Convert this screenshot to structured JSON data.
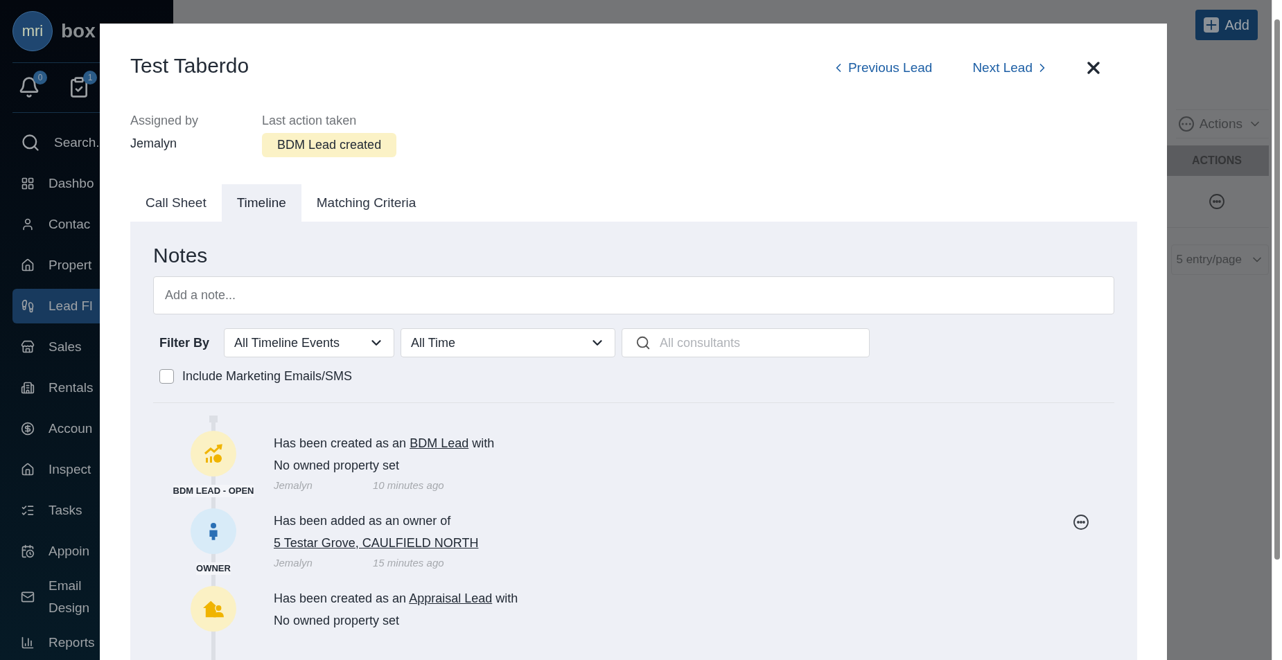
{
  "background": {
    "add_button": "Add",
    "actions_dropdown": "Actions",
    "column_header": "ACTIONS",
    "entries_dropdown": "5 entry/page"
  },
  "sidebar": {
    "logo": "mri",
    "brand": "box",
    "counters": [
      {
        "kind": "notifications",
        "badge": "0"
      },
      {
        "kind": "tasks",
        "badge": "1"
      }
    ],
    "items": [
      {
        "kind": "search",
        "label": "Search.",
        "selected": false
      },
      {
        "kind": "dashboard",
        "label": "Dashbo",
        "selected": false
      },
      {
        "kind": "contacts",
        "label": "Contac",
        "selected": false
      },
      {
        "kind": "properties",
        "label": "Propert",
        "selected": false
      },
      {
        "kind": "leadflow",
        "label": "Lead Fl",
        "selected": true
      },
      {
        "kind": "sales",
        "label": "Sales",
        "selected": false
      },
      {
        "kind": "rentals",
        "label": "Rentals",
        "selected": false
      },
      {
        "kind": "accounts",
        "label": "Accoun",
        "selected": false
      },
      {
        "kind": "inspections",
        "label": "Inspect",
        "selected": false
      },
      {
        "kind": "tasks",
        "label": "Tasks",
        "selected": false
      },
      {
        "kind": "appointments",
        "label": "Appoin",
        "selected": false
      },
      {
        "kind": "email",
        "label": "Email Design",
        "selected": false
      },
      {
        "kind": "reports",
        "label": "Reports",
        "selected": false
      }
    ]
  },
  "modal": {
    "title": "Test Taberdo",
    "previous": "Previous Lead",
    "next": "Next Lead",
    "assigned_by_label": "Assigned by",
    "assigned_by": "Jemalyn",
    "last_action_label": "Last action taken",
    "last_action": "BDM Lead created",
    "tabs": [
      {
        "label": "Call Sheet",
        "selected": false
      },
      {
        "label": "Timeline",
        "selected": true
      },
      {
        "label": "Matching Criteria",
        "selected": false
      }
    ],
    "notes": {
      "heading": "Notes",
      "placeholder": "Add a note..."
    },
    "filter": {
      "label": "Filter By",
      "event_filter": "All Timeline Events",
      "time_filter": "All Time",
      "consultant_placeholder": "All consultants"
    },
    "include_marketing": {
      "label": "Include Marketing Emails/SMS",
      "checked": false
    },
    "timeline": [
      {
        "kind": "bdm",
        "label": "BDM LEAD - OPEN",
        "lines": [
          [
            {
              "text": "Has been created as an ",
              "link": false
            },
            {
              "text": "BDM Lead",
              "link": true
            },
            {
              "text": " with",
              "link": false
            }
          ],
          [
            {
              "text": "No owned property set",
              "link": false
            }
          ]
        ],
        "author": "Jemalyn",
        "time": "10 minutes ago",
        "menu": false
      },
      {
        "kind": "owner",
        "label": "OWNER",
        "lines": [
          [
            {
              "text": "Has been added as an owner of",
              "link": false
            }
          ],
          [
            {
              "text": "5 Testar Grove, CAULFIELD NORTH",
              "link": true
            }
          ]
        ],
        "author": "Jemalyn",
        "time": "15 minutes ago",
        "menu": true
      },
      {
        "kind": "appraisal",
        "lines": [
          [
            {
              "text": "Has been created as an ",
              "link": false
            },
            {
              "text": "Appraisal Lead",
              "link": true
            },
            {
              "text": " with",
              "link": false
            }
          ],
          [
            {
              "text": "No owned property set",
              "link": false
            }
          ]
        ],
        "menu": false
      }
    ]
  }
}
